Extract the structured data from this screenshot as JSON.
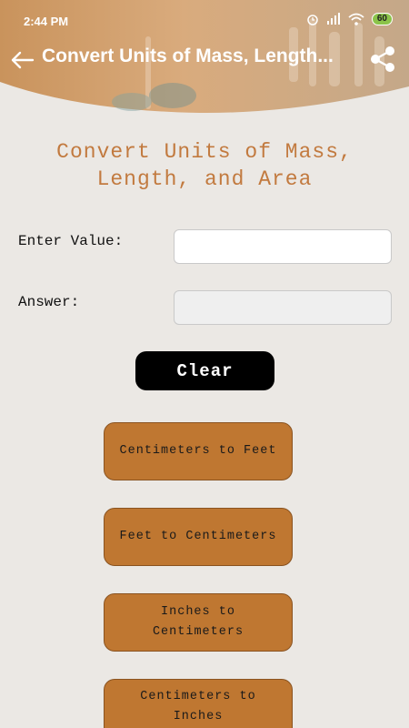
{
  "status_bar": {
    "time": "2:44 PM",
    "battery": "60"
  },
  "toolbar": {
    "title": "Convert Units of Mass, Length..."
  },
  "heading": "Convert Units of Mass, Length, and Area",
  "form": {
    "value_label": "Enter Value:",
    "value_input": "",
    "answer_label": "Answer:",
    "answer_value": ""
  },
  "clear_label": "Clear",
  "conversions": [
    "Centimeters to Feet",
    "Feet to Centimeters",
    "Inches to Centimeters",
    "Centimeters to Inches"
  ],
  "colors": {
    "header_tan": "#d9a877",
    "accent_text": "#c27a3f",
    "button": "#bf7731",
    "background": "#ebe8e4"
  }
}
